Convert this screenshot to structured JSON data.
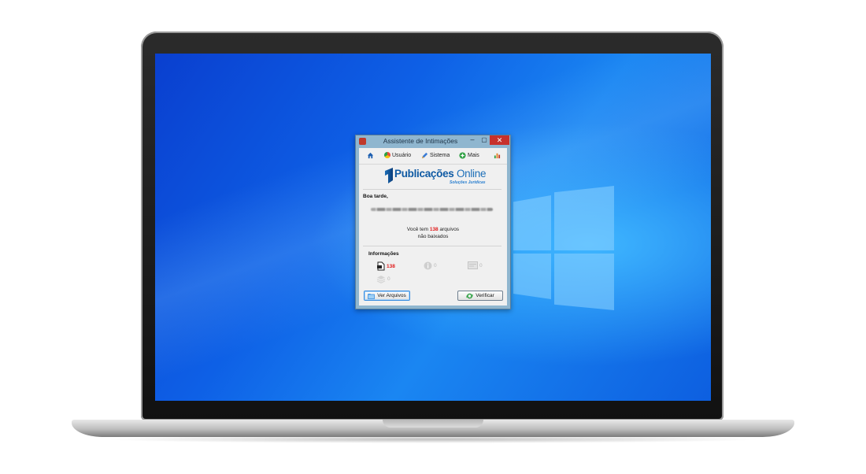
{
  "window": {
    "title": "Assistente de Intimações",
    "controls": {
      "minimize": "‒",
      "maximize": "▢",
      "close": "✕"
    }
  },
  "toolbar": {
    "home_icon": "home-icon",
    "items": [
      {
        "label": "Usuário",
        "icon": "user-icon"
      },
      {
        "label": "Sistema",
        "icon": "pencil-icon"
      },
      {
        "label": "Mais",
        "icon": "plus-icon"
      }
    ],
    "stats_icon": "chart-icon"
  },
  "logo": {
    "brand_bold": "Publicações",
    "brand_light": " Online",
    "tagline": "Soluções Jurídicas"
  },
  "greeting": "Boa tarde,",
  "message": {
    "prefix": "Você tem ",
    "count": "138",
    "suffix": " arquivos",
    "line2": "não baixados"
  },
  "info": {
    "title": "Informações",
    "items": [
      {
        "icon": "document-icon",
        "value": "138",
        "color": "#e01b1b"
      },
      {
        "icon": "info-icon",
        "value": "0",
        "color": "#b8b8b8"
      },
      {
        "icon": "card-icon",
        "value": "0",
        "color": "#b8b8b8"
      },
      {
        "icon": "stack-icon",
        "value": "0",
        "color": "#b8b8b8"
      }
    ]
  },
  "buttons": {
    "view_files": "Ver Arquivos",
    "verify": "Verificar"
  },
  "colors": {
    "desktop_blue": "#0e60e6",
    "close_red": "#c7312c",
    "brand_blue": "#1d6fb8",
    "alert_red": "#e01b1b"
  }
}
